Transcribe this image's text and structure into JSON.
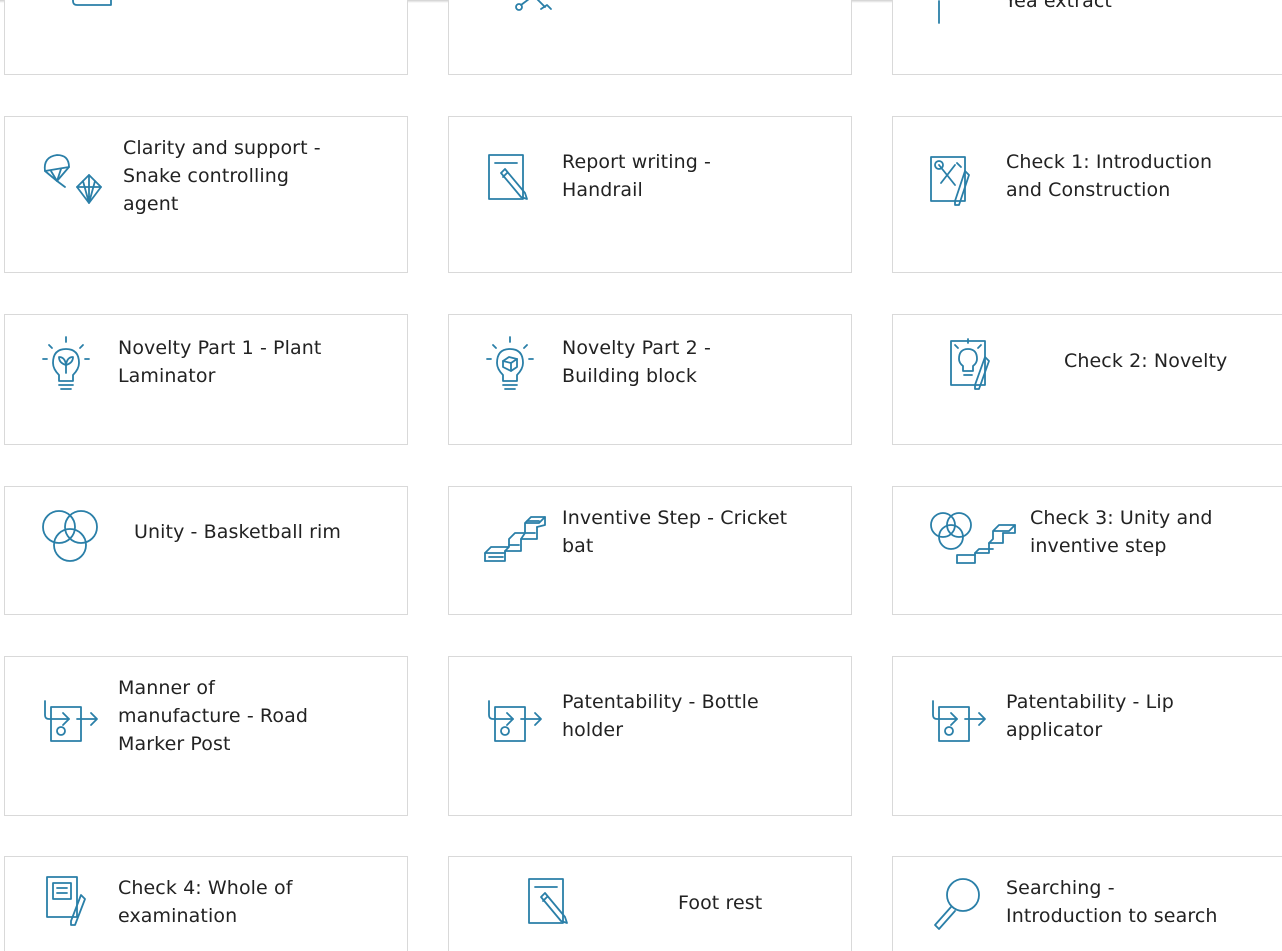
{
  "cards": [
    {
      "label": ""
    },
    {
      "label": ""
    },
    {
      "label": "Yea extract"
    },
    {
      "label": "Clarity and support -\nSnake controlling\nagent"
    },
    {
      "label": "Report writing -\nHandrail"
    },
    {
      "label": "Check 1: Introduction\nand Construction"
    },
    {
      "label": "Novelty Part 1 - Plant\nLaminator"
    },
    {
      "label": "Novelty Part 2 -\nBuilding block"
    },
    {
      "label": "Check 2: Novelty"
    },
    {
      "label": "Unity - Basketball rim"
    },
    {
      "label": "Inventive Step - Cricket\nbat"
    },
    {
      "label": "Check 3: Unity and\ninventive step"
    },
    {
      "label": "Manner of\nmanufacture - Road\nMarker Post"
    },
    {
      "label": "Patentability - Bottle\nholder"
    },
    {
      "label": "Patentability - Lip\napplicator"
    },
    {
      "label": "Check 4: Whole of\nexamination"
    },
    {
      "label": "Foot rest"
    },
    {
      "label": "Searching -\nIntroduction to search"
    }
  ],
  "colors": {
    "icon": "#2a7fa8",
    "border": "#d9d9d9",
    "text": "#222222"
  }
}
